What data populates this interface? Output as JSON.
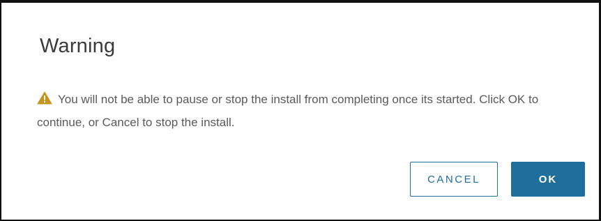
{
  "dialog": {
    "title": "Warning",
    "message": "You will not be able to pause or stop the install from completing once its started. Click OK to continue, or Cancel to stop the install.",
    "icon": "warning-icon",
    "cancel_label": "CANCEL",
    "ok_label": "OK"
  },
  "colors": {
    "primary": "#1f6e9c",
    "warning": "#c4951c",
    "title_text": "#3a3a3a",
    "body_text": "#5a5a5a"
  }
}
